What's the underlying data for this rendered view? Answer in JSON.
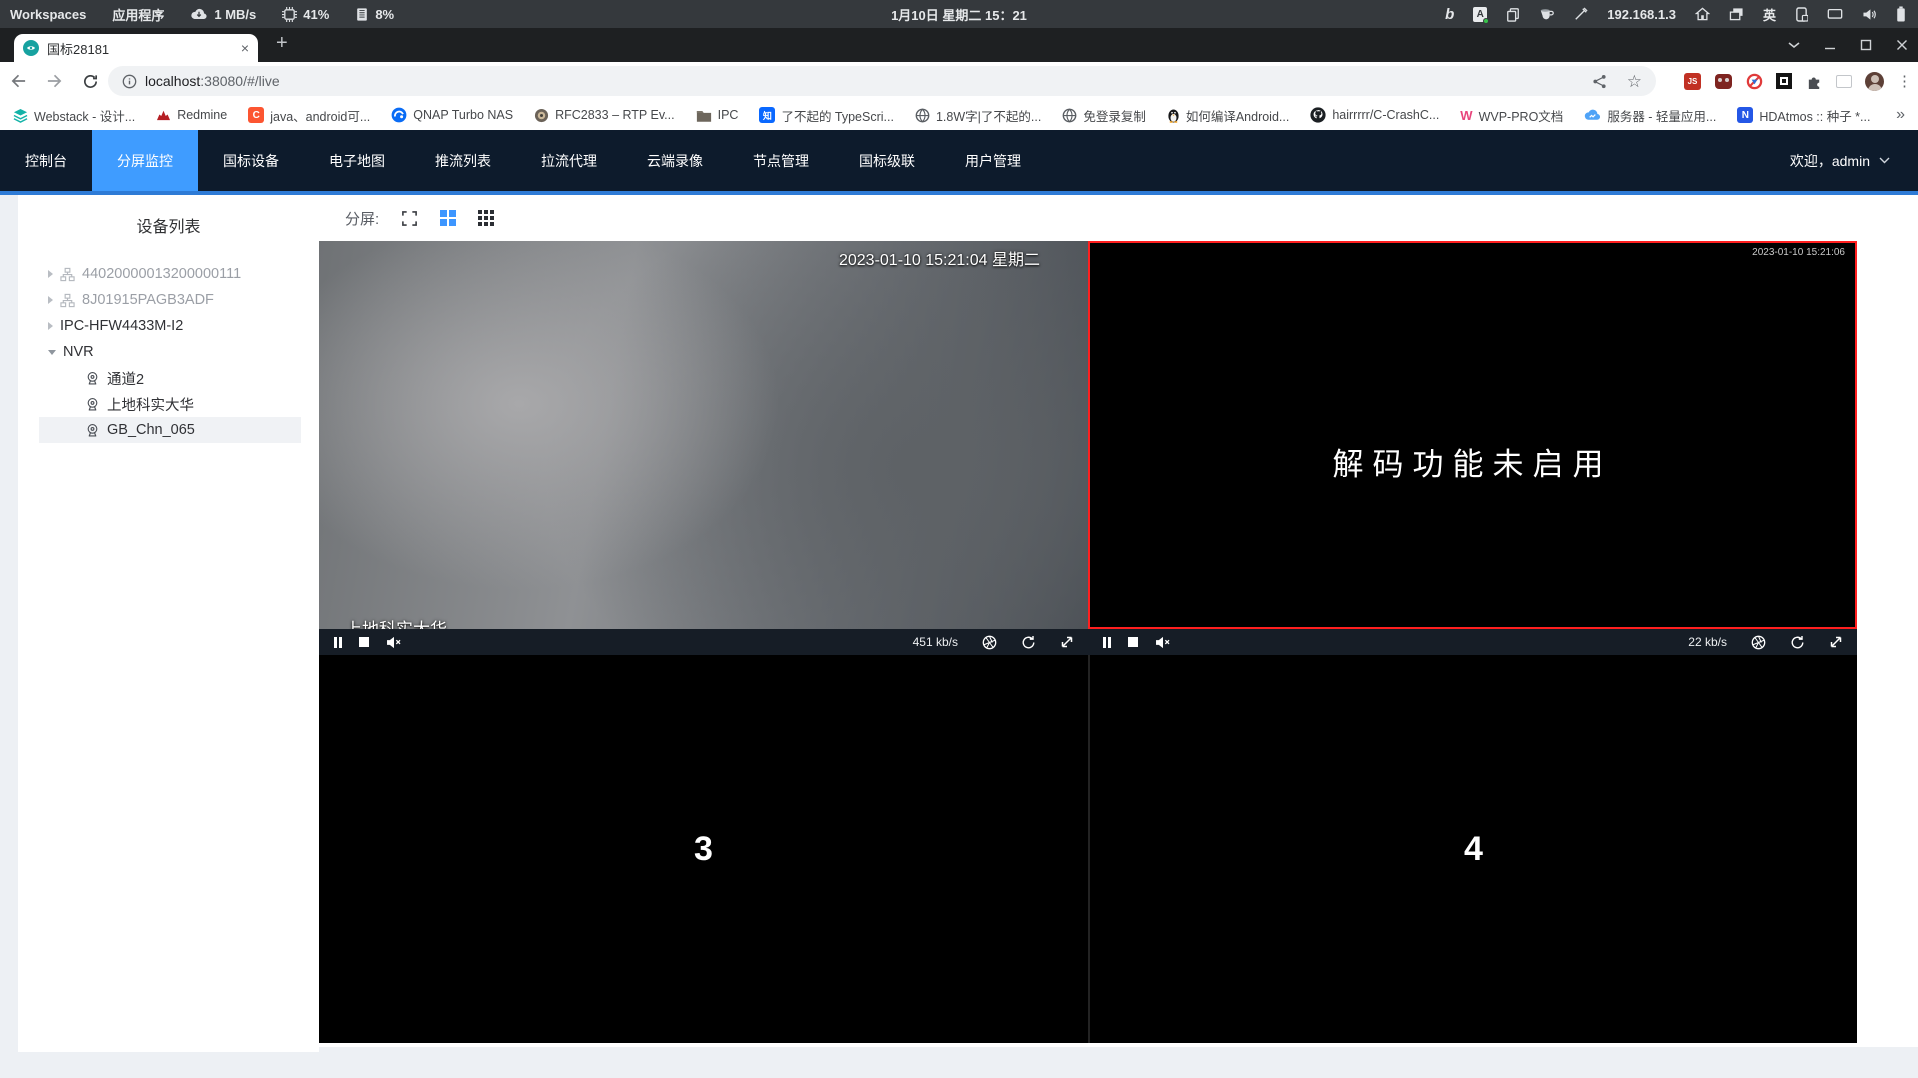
{
  "colors": {
    "accent": "#3f9cff",
    "selected_player_border": "#ff1f1f",
    "navbar_bg": "#0d1b2c"
  },
  "sysbar": {
    "workspaces": "Workspaces",
    "applications": "应用程序",
    "net_speed": "1 MB/s",
    "cpu_usage": "41%",
    "mem_usage": "8%",
    "clock": "1月10日 星期二 15：21",
    "ip": "192.168.1.3",
    "ime": "英"
  },
  "glyphs": {
    "bing": "b",
    "doc": "A",
    "js": "JS",
    "csdn": "C",
    "zhihu": "知",
    "wvp": "W",
    "hdatmos": "N",
    "star": "☆",
    "kebab": "⋮",
    "plus": "+",
    "close": "×",
    "overflow": "»"
  },
  "browser": {
    "tab_title": "国标28181",
    "url_host": "localhost",
    "url_rest": ":38080/#/live",
    "bookmarks": [
      {
        "label": "Webstack - 设计..."
      },
      {
        "label": "Redmine"
      },
      {
        "label": "java、android可..."
      },
      {
        "label": "QNAP Turbo NAS"
      },
      {
        "label": "RFC2833 – RTP Ev..."
      },
      {
        "label": "IPC"
      },
      {
        "label": "了不起的 TypeScri..."
      },
      {
        "label": "1.8W字|了不起的..."
      },
      {
        "label": "免登录复制"
      },
      {
        "label": "如何编译Android..."
      },
      {
        "label": "hairrrrr/C-CrashC..."
      },
      {
        "label": "WVP-PRO文档"
      },
      {
        "label": "服务器 - 轻量应用..."
      },
      {
        "label": "HDAtmos :: 种子 *..."
      }
    ]
  },
  "nav": {
    "tabs": [
      "控制台",
      "分屏监控",
      "国标设备",
      "电子地图",
      "推流列表",
      "拉流代理",
      "云端录像",
      "节点管理",
      "国标级联",
      "用户管理"
    ],
    "active_tab": "分屏监控",
    "welcome": "欢迎，admin"
  },
  "sidebar": {
    "title": "设备列表",
    "devices": [
      {
        "label": "44020000013200000111"
      },
      {
        "label": "8J01915PAGB3ADF"
      },
      {
        "label": "IPC-HFW4433M-I2"
      },
      {
        "label": "NVR"
      },
      {
        "label": "通道2"
      },
      {
        "label": "上地科实大华"
      },
      {
        "label": "GB_Chn_065"
      }
    ]
  },
  "toolbar": {
    "split_label": "分屏:"
  },
  "players": {
    "p1": {
      "osd_time": "2023-01-10 15:21:04 星期二",
      "osd_label": "上地科实大华",
      "bitrate": "451 kb/s"
    },
    "p2": {
      "osd_time": "2023-01-10 15:21:06",
      "message": "解码功能未启用",
      "bitrate": "22 kb/s"
    },
    "p3": {
      "number": "3"
    },
    "p4": {
      "number": "4"
    }
  }
}
